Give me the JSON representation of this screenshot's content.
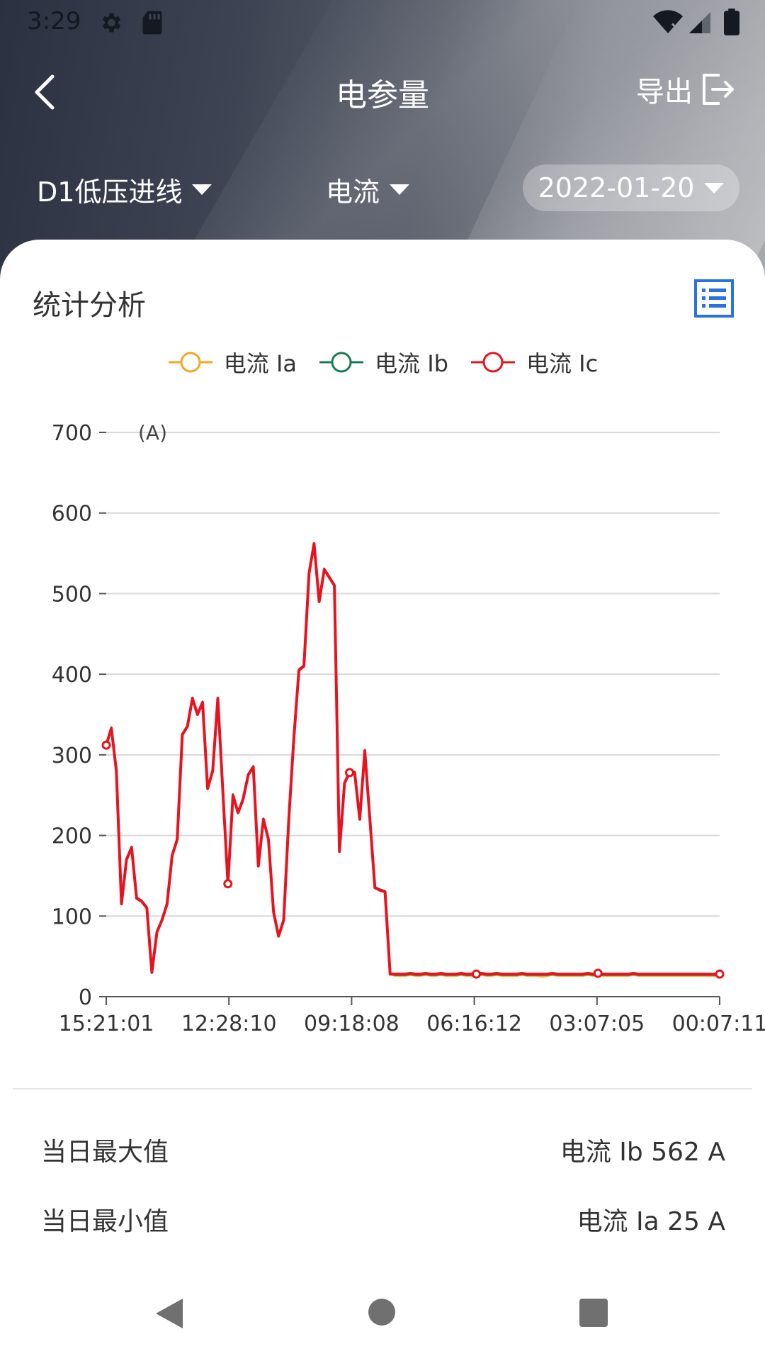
{
  "status_bar": {
    "time": "3:29"
  },
  "app_bar": {
    "title": "电参量",
    "export_label": "导出"
  },
  "filters": {
    "device": "D1低压进线",
    "parameter": "电流",
    "date": "2022-01-20"
  },
  "section": {
    "title": "统计分析"
  },
  "colors": {
    "series_a": "#f5a623",
    "series_b": "#1b7a56",
    "series_c": "#e8131f",
    "grid": "#d8d8d8"
  },
  "chart_data": {
    "type": "line",
    "unit_label": "(A)",
    "legend": [
      "电流 Ia",
      "电流 Ib",
      "电流 Ic"
    ],
    "x_tick_labels": [
      "15:21:01",
      "12:28:10",
      "09:18:08",
      "06:16:12",
      "03:07:05",
      "00:07:11"
    ],
    "y_ticks": [
      0,
      100,
      200,
      300,
      400,
      500,
      600,
      700
    ],
    "ylim": [
      0,
      700
    ],
    "grid": true,
    "legend_position": "top-center",
    "series": [
      {
        "name": "电流 Ia",
        "values": [
          312,
          333,
          280,
          115,
          170,
          185,
          122,
          118,
          110,
          30,
          80,
          95,
          115,
          175,
          195,
          325,
          335,
          370,
          350,
          365,
          258,
          280,
          370,
          255,
          140,
          250,
          228,
          245,
          275,
          285,
          162,
          220,
          195,
          105,
          75,
          95,
          220,
          320,
          405,
          410,
          525,
          562,
          490,
          530,
          520,
          510,
          180,
          265,
          278,
          278,
          220,
          305,
          220,
          135,
          132,
          130,
          28,
          26,
          26,
          26,
          27,
          26,
          26,
          27,
          26,
          26,
          27,
          26,
          26,
          26,
          27,
          26,
          26,
          26,
          27,
          26,
          26,
          27,
          26,
          26,
          26,
          26,
          27,
          26,
          26,
          26,
          25,
          26,
          27,
          26,
          26,
          26,
          26,
          26,
          26,
          27,
          26,
          27,
          26,
          26,
          26,
          26,
          26,
          26,
          27,
          26,
          26,
          26,
          26,
          26,
          26,
          26,
          26,
          26,
          26,
          26,
          26,
          26,
          26,
          26,
          26,
          26
        ]
      },
      {
        "name": "电流 Ib",
        "values": [
          313,
          334,
          281,
          116,
          171,
          186,
          123,
          119,
          111,
          31,
          81,
          96,
          116,
          176,
          196,
          326,
          336,
          371,
          351,
          366,
          259,
          281,
          371,
          256,
          141,
          251,
          229,
          246,
          276,
          286,
          163,
          221,
          196,
          106,
          76,
          96,
          221,
          321,
          406,
          411,
          526,
          562,
          491,
          531,
          521,
          511,
          181,
          266,
          279,
          279,
          221,
          306,
          221,
          136,
          133,
          131,
          29,
          27,
          27,
          27,
          28,
          27,
          27,
          28,
          27,
          27,
          28,
          27,
          27,
          27,
          28,
          27,
          27,
          27,
          28,
          27,
          27,
          28,
          27,
          27,
          27,
          27,
          28,
          27,
          27,
          27,
          27,
          27,
          28,
          27,
          27,
          27,
          27,
          27,
          27,
          28,
          27,
          28,
          27,
          27,
          27,
          27,
          27,
          27,
          28,
          27,
          27,
          27,
          27,
          27,
          27,
          27,
          27,
          27,
          27,
          27,
          27,
          27,
          27,
          27,
          27,
          27
        ]
      },
      {
        "name": "电流 Ic",
        "values": [
          312,
          333,
          280,
          115,
          170,
          185,
          122,
          118,
          110,
          30,
          80,
          95,
          115,
          175,
          195,
          325,
          335,
          370,
          350,
          365,
          258,
          280,
          370,
          255,
          140,
          250,
          228,
          245,
          275,
          285,
          162,
          220,
          195,
          105,
          75,
          95,
          220,
          320,
          405,
          410,
          525,
          562,
          490,
          530,
          520,
          510,
          180,
          265,
          278,
          278,
          220,
          305,
          220,
          135,
          132,
          130,
          28,
          28,
          28,
          28,
          29,
          28,
          28,
          29,
          28,
          28,
          29,
          28,
          28,
          28,
          29,
          28,
          28,
          28,
          29,
          28,
          28,
          29,
          28,
          28,
          28,
          28,
          29,
          28,
          28,
          28,
          28,
          28,
          29,
          28,
          28,
          28,
          28,
          28,
          28,
          29,
          28,
          29,
          28,
          28,
          28,
          28,
          28,
          28,
          29,
          28,
          28,
          28,
          28,
          28,
          28,
          28,
          28,
          28,
          28,
          28,
          28,
          28,
          28,
          28,
          28,
          28
        ]
      }
    ]
  },
  "stats": {
    "max_label": "当日最大值",
    "max_value": "电流 Ib 562 A",
    "min_label": "当日最小值",
    "min_value": "电流 Ia 25 A"
  }
}
